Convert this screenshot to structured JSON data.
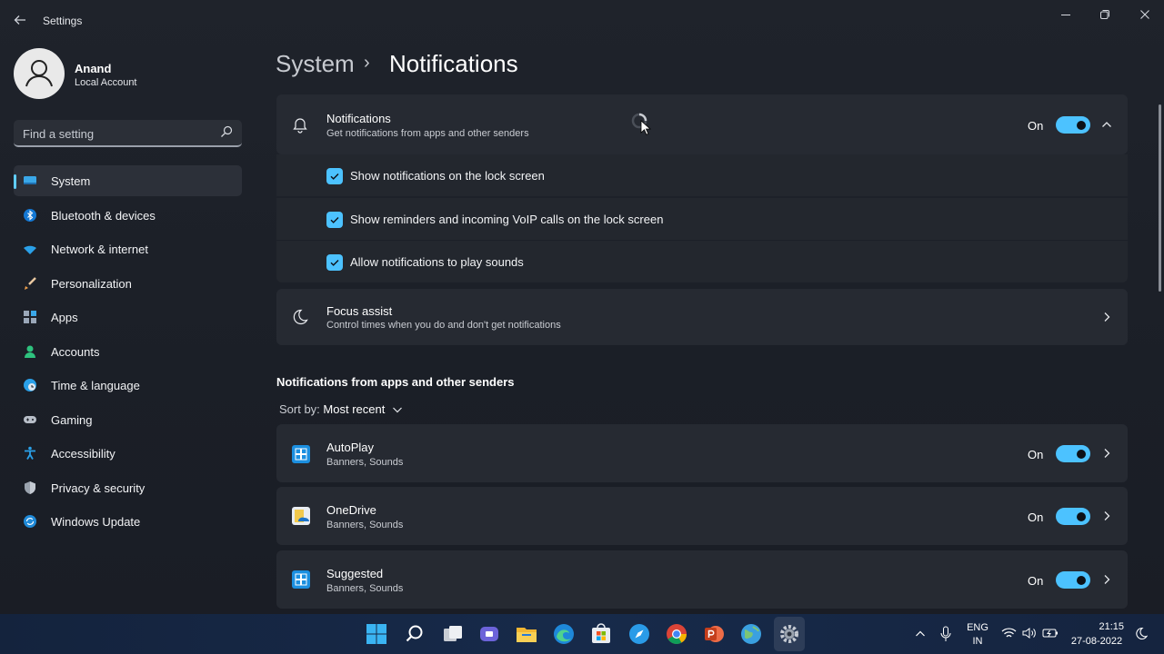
{
  "window": {
    "title": "Settings",
    "controls": {
      "minimize": "—",
      "maximize": "❐",
      "close": "✕"
    }
  },
  "user": {
    "name": "Anand",
    "account_type": "Local Account"
  },
  "search": {
    "placeholder": "Find a setting"
  },
  "sidebar": {
    "items": [
      {
        "label": "System",
        "icon": "system-icon",
        "active": true
      },
      {
        "label": "Bluetooth & devices",
        "icon": "bluetooth-icon"
      },
      {
        "label": "Network & internet",
        "icon": "wifi-icon"
      },
      {
        "label": "Personalization",
        "icon": "brush-icon"
      },
      {
        "label": "Apps",
        "icon": "apps-icon"
      },
      {
        "label": "Accounts",
        "icon": "person-icon"
      },
      {
        "label": "Time & language",
        "icon": "clock-globe-icon"
      },
      {
        "label": "Gaming",
        "icon": "gamepad-icon"
      },
      {
        "label": "Accessibility",
        "icon": "accessibility-icon"
      },
      {
        "label": "Privacy & security",
        "icon": "shield-icon"
      },
      {
        "label": "Windows Update",
        "icon": "update-icon"
      }
    ]
  },
  "breadcrumb": {
    "parent": "System",
    "separator": "›",
    "current": "Notifications"
  },
  "notifications_card": {
    "title": "Notifications",
    "subtitle": "Get notifications from apps and other senders",
    "state_label": "On",
    "enabled": true,
    "expanded": true,
    "options": [
      {
        "label": "Show notifications on the lock screen",
        "checked": true
      },
      {
        "label": "Show reminders and incoming VoIP calls on the lock screen",
        "checked": true
      },
      {
        "label": "Allow notifications to play sounds",
        "checked": true
      }
    ]
  },
  "focus_assist": {
    "title": "Focus assist",
    "subtitle": "Control times when you do and don't get notifications"
  },
  "senders_section": {
    "title": "Notifications from apps and other senders",
    "sort_prefix": "Sort by:",
    "sort_value": "Most recent",
    "apps": [
      {
        "name": "AutoPlay",
        "detail": "Banners, Sounds",
        "state_label": "On",
        "enabled": true,
        "icon": "autoplay-icon"
      },
      {
        "name": "OneDrive",
        "detail": "Banners, Sounds",
        "state_label": "On",
        "enabled": true,
        "icon": "onedrive-icon"
      },
      {
        "name": "Suggested",
        "detail": "Banners, Sounds",
        "state_label": "On",
        "enabled": true,
        "icon": "suggested-icon"
      }
    ]
  },
  "taskbar": {
    "apps": [
      "start",
      "search",
      "task-view",
      "teams-chat",
      "file-explorer",
      "edge",
      "store",
      "safari-like",
      "chrome",
      "powerpoint",
      "maps",
      "settings"
    ],
    "tray": {
      "language_top": "ENG",
      "language_bottom": "IN",
      "time": "21:15",
      "date": "27-08-2022"
    }
  },
  "colors": {
    "accent": "#4cc2ff",
    "window_bg": "#1f232b",
    "card_bg": "#262a32"
  }
}
